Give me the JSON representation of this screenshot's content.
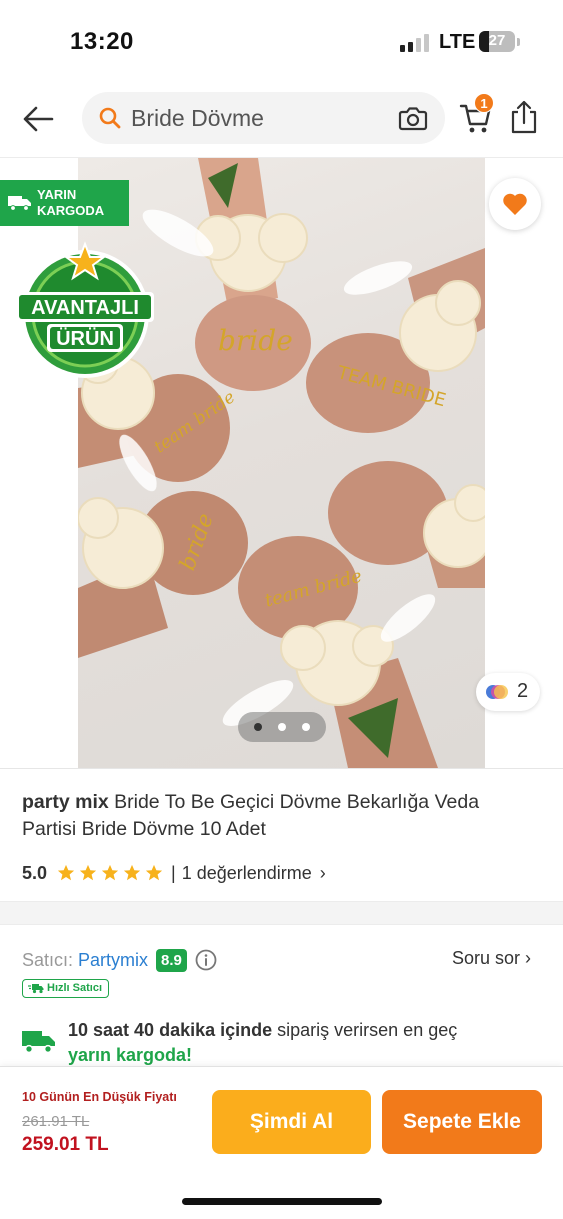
{
  "status_bar": {
    "time": "13:20",
    "network": "LTE",
    "battery": "27"
  },
  "header": {
    "search_value": "Bride Dövme",
    "cart_count": "1"
  },
  "gallery": {
    "cargo_badge": {
      "line1": "YARIN",
      "line2": "KARGODA"
    },
    "promo_badge": {
      "line1": "AVANTAJLI",
      "line2": "ÜRÜN"
    },
    "variant_count": "2",
    "page_count": 3,
    "active_page": 1,
    "tattoo_texts": [
      "bride",
      "TEAM BRIDE",
      "team bride",
      "bride",
      "team bride"
    ]
  },
  "product": {
    "brand": "party mix",
    "name": "Bride To Be  Geçici Dövme Bekarlığa Veda Partisi Bride Dövme 10 Adet",
    "rating": "5.0",
    "stars": 5,
    "separator": "|",
    "review_text": "1 değerlendirme",
    "review_chevron": "›"
  },
  "seller": {
    "label": "Satıcı:",
    "name": "Partymix",
    "score": "8.9",
    "ask_label": "Soru sor ›",
    "fast_label": "Hızlı Satıcı"
  },
  "delivery": {
    "bold": "10 saat 40 dakika içinde",
    "rest": " sipariş verirsen en geç",
    "highlight": "yarın kargoda!"
  },
  "bottom_bar": {
    "lowest_label": "10 Günün En Düşük Fiyatı",
    "old_price": "261.91 TL",
    "new_price": "259.01 TL",
    "buy_now": "Şimdi Al",
    "add_to_cart": "Sepete Ekle"
  },
  "colors": {
    "brand_orange": "#f27a1a",
    "buy_yellow": "#fbad1c",
    "green": "#1fa54a",
    "price_red": "#c1121f",
    "link_blue": "#2b7fd1"
  }
}
